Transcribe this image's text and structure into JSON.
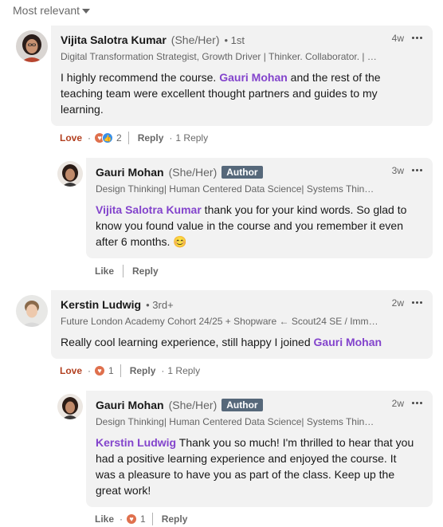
{
  "sort": {
    "label": "Most relevant"
  },
  "comments": [
    {
      "name": "Vijita Salotra Kumar",
      "pronouns": "(She/Her)",
      "degree": "• 1st",
      "headline": "Digital Transformation Strategist, Growth Driver | Thinker. Collaborator. | Li...",
      "time": "4w",
      "text_before": "I highly recommend the course. ",
      "mention": "Gauri Mohan",
      "text_after": " and the rest of the teaching team were excellent thought partners and guides to my learning.",
      "reaction_label": "Love",
      "reaction_count": "2",
      "reply_label": "Reply",
      "replies_count": "1 Reply"
    },
    {
      "name": "Gauri Mohan",
      "pronouns": "(She/Her)",
      "badge": "Author",
      "headline": "Design Thinking| Human Centered Data Science| Systems Thinkin...",
      "time": "3w",
      "mention": "Vijita Salotra Kumar",
      "text_after": " thank you for your kind words. So glad to know you found value in the course and you remember it even after 6 months. 😊",
      "like_label": "Like",
      "reply_label": "Reply"
    },
    {
      "name": "Kerstin Ludwig",
      "degree": "• 3rd+",
      "headline": "Future London Academy Cohort 24/25 + Shopware ← Scout24 SE / Immo...",
      "time": "2w",
      "text_before": "Really cool learning experience, still happy I joined ",
      "mention": "Gauri Mohan",
      "reaction_label": "Love",
      "reaction_count": "1",
      "reply_label": "Reply",
      "replies_count": "1 Reply"
    },
    {
      "name": "Gauri Mohan",
      "pronouns": "(She/Her)",
      "badge": "Author",
      "headline": "Design Thinking| Human Centered Data Science| Systems Thinkin...",
      "time": "2w",
      "mention": "Kerstin Ludwig",
      "text_after": " Thank you so much! I'm thrilled to hear that you had a positive learning experience and enjoyed the course. It was a pleasure to have you as part of the class. Keep up the great work!",
      "like_label": "Like",
      "reaction_count": "1",
      "reply_label": "Reply"
    }
  ],
  "colors": {
    "love": "#b24020",
    "mention": "#8344cc",
    "author_badge": "#56687a",
    "bubble": "#f2f2f2"
  }
}
